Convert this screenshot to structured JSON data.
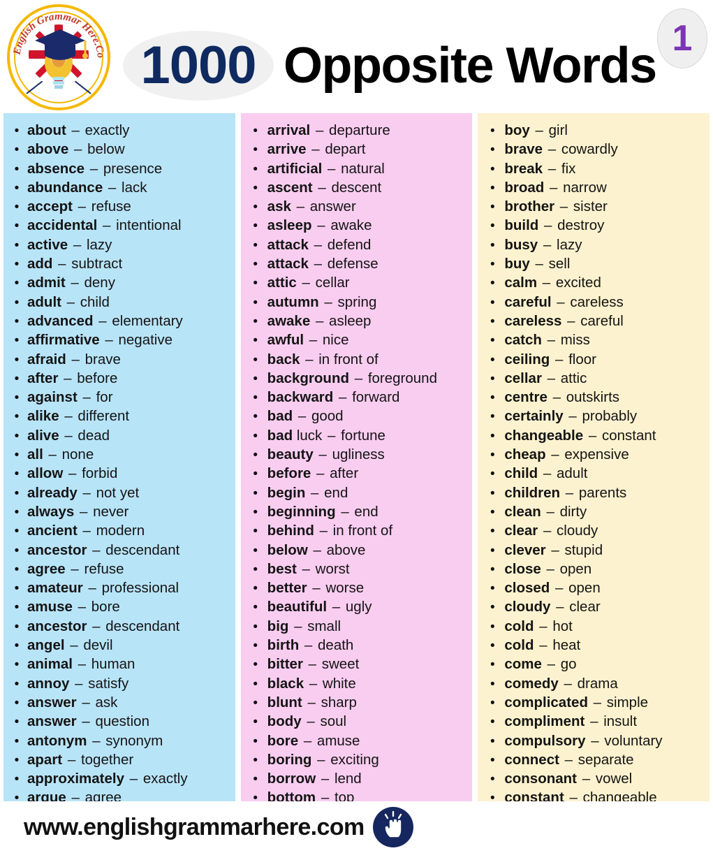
{
  "header": {
    "title_number": "1000",
    "title_text": "Opposite Words",
    "page_number": "1",
    "logo_text": "English Grammar Here.Com",
    "colors": {
      "number_navy": "#0e2a60",
      "page_badge_purple": "#7b35b5",
      "column_blue": "#b8e4f8",
      "column_pink": "#f9cdf0",
      "column_cream": "#fdf2cf",
      "footer_navy": "#16265e"
    }
  },
  "footer": {
    "site_url": "www.englishgrammarhere.com",
    "icon": "click-hand-icon"
  },
  "columns": [
    {
      "background": "#b8e4f8",
      "items": [
        {
          "word": "about",
          "opposite": "exactly"
        },
        {
          "word": "above",
          "opposite": "below"
        },
        {
          "word": "absence",
          "opposite": "presence"
        },
        {
          "word": "abundance",
          "opposite": "lack"
        },
        {
          "word": "accept",
          "opposite": "refuse"
        },
        {
          "word": "accidental",
          "opposite": "intentional"
        },
        {
          "word": "active",
          "opposite": "lazy"
        },
        {
          "word": "add",
          "opposite": "subtract"
        },
        {
          "word": "admit",
          "opposite": "deny"
        },
        {
          "word": "adult",
          "opposite": "child"
        },
        {
          "word": "advanced",
          "opposite": "elementary"
        },
        {
          "word": "affirmative",
          "opposite": "negative"
        },
        {
          "word": "afraid",
          "opposite": "brave"
        },
        {
          "word": "after",
          "opposite": "before"
        },
        {
          "word": "against",
          "opposite": "for"
        },
        {
          "word": "alike",
          "opposite": "different"
        },
        {
          "word": "alive",
          "opposite": "dead"
        },
        {
          "word": "all",
          "opposite": "none"
        },
        {
          "word": "allow",
          "opposite": "forbid"
        },
        {
          "word": "already",
          "opposite": "not yet"
        },
        {
          "word": "always",
          "opposite": "never"
        },
        {
          "word": "ancient",
          "opposite": "modern"
        },
        {
          "word": "ancestor",
          "opposite": "descendant"
        },
        {
          "word": "agree",
          "opposite": "refuse"
        },
        {
          "word": "amateur",
          "opposite": "professional"
        },
        {
          "word": "amuse",
          "opposite": "bore"
        },
        {
          "word": "ancestor",
          "opposite": "descendant"
        },
        {
          "word": "angel",
          "opposite": "devil"
        },
        {
          "word": "animal",
          "opposite": "human"
        },
        {
          "word": "annoy",
          "opposite": "satisfy"
        },
        {
          "word": "answer",
          "opposite": "ask"
        },
        {
          "word": "answer",
          "opposite": "question"
        },
        {
          "word": "antonym",
          "opposite": "synonym"
        },
        {
          "word": "apart",
          "opposite": "together"
        },
        {
          "word": "approximately",
          "opposite": "exactly"
        },
        {
          "word": "argue",
          "opposite": "agree"
        }
      ]
    },
    {
      "background": "#f9cdf0",
      "items": [
        {
          "word": "arrival",
          "opposite": "departure"
        },
        {
          "word": "arrive",
          "opposite": "depart"
        },
        {
          "word": "artificial",
          "opposite": "natural"
        },
        {
          "word": "ascent",
          "opposite": "descent"
        },
        {
          "word": "ask",
          "opposite": "answer"
        },
        {
          "word": "asleep",
          "opposite": "awake"
        },
        {
          "word": "attack",
          "opposite": "defend"
        },
        {
          "word": "attack",
          "opposite": "defense"
        },
        {
          "word": "attic",
          "opposite": "cellar"
        },
        {
          "word": "autumn",
          "opposite": "spring"
        },
        {
          "word": "awake",
          "opposite": "asleep"
        },
        {
          "word": "awful",
          "opposite": "nice"
        },
        {
          "word": "back",
          "opposite": "in front of"
        },
        {
          "word": "background",
          "opposite": "foreground"
        },
        {
          "word": "backward",
          "opposite": "forward"
        },
        {
          "word": "bad",
          "opposite": "good"
        },
        {
          "word": "bad",
          "suffix": "luck",
          "opposite": "fortune"
        },
        {
          "word": "beauty",
          "opposite": "ugliness"
        },
        {
          "word": "before",
          "opposite": "after"
        },
        {
          "word": "begin",
          "opposite": "end"
        },
        {
          "word": "beginning",
          "opposite": "end"
        },
        {
          "word": "behind",
          "opposite": "in front of"
        },
        {
          "word": "below",
          "opposite": "above"
        },
        {
          "word": "best",
          "opposite": "worst"
        },
        {
          "word": "better",
          "opposite": "worse"
        },
        {
          "word": "beautiful",
          "opposite": "ugly"
        },
        {
          "word": "big",
          "opposite": "small"
        },
        {
          "word": "birth",
          "opposite": "death"
        },
        {
          "word": "bitter",
          "opposite": "sweet"
        },
        {
          "word": "black",
          "opposite": "white"
        },
        {
          "word": "blunt",
          "opposite": "sharp"
        },
        {
          "word": "body",
          "opposite": "soul"
        },
        {
          "word": "bore",
          "opposite": "amuse"
        },
        {
          "word": "boring",
          "opposite": "exciting"
        },
        {
          "word": "borrow",
          "opposite": "lend"
        },
        {
          "word": "bottom",
          "opposite": "top"
        }
      ]
    },
    {
      "background": "#fdf2cf",
      "items": [
        {
          "word": "boy",
          "opposite": "girl"
        },
        {
          "word": "brave",
          "opposite": "cowardly"
        },
        {
          "word": "break",
          "opposite": "fix"
        },
        {
          "word": "broad",
          "opposite": "narrow"
        },
        {
          "word": "brother",
          "opposite": "sister"
        },
        {
          "word": "build",
          "opposite": "destroy"
        },
        {
          "word": "busy",
          "opposite": "lazy"
        },
        {
          "word": "buy",
          "opposite": "sell"
        },
        {
          "word": "calm",
          "opposite": "excited"
        },
        {
          "word": "careful",
          "opposite": "careless"
        },
        {
          "word": "careless",
          "opposite": "careful"
        },
        {
          "word": "catch",
          "opposite": "miss"
        },
        {
          "word": "ceiling",
          "opposite": "floor"
        },
        {
          "word": "cellar",
          "opposite": "attic"
        },
        {
          "word": "centre",
          "opposite": "outskirts"
        },
        {
          "word": "certainly",
          "opposite": "probably"
        },
        {
          "word": "changeable",
          "opposite": "constant"
        },
        {
          "word": "cheap",
          "opposite": "expensive"
        },
        {
          "word": "child",
          "opposite": "adult"
        },
        {
          "word": "children",
          "opposite": "parents"
        },
        {
          "word": "clean",
          "opposite": "dirty"
        },
        {
          "word": "clear",
          "opposite": "cloudy"
        },
        {
          "word": "clever",
          "opposite": "stupid"
        },
        {
          "word": "close",
          "opposite": "open"
        },
        {
          "word": "closed",
          "opposite": "open"
        },
        {
          "word": "cloudy",
          "opposite": "clear"
        },
        {
          "word": "cold",
          "opposite": "hot"
        },
        {
          "word": "cold",
          "opposite": "heat"
        },
        {
          "word": "come",
          "opposite": "go"
        },
        {
          "word": "comedy",
          "opposite": "drama"
        },
        {
          "word": "complicated",
          "opposite": "simple"
        },
        {
          "word": "compliment",
          "opposite": "insult"
        },
        {
          "word": "compulsory",
          "opposite": "voluntary"
        },
        {
          "word": "connect",
          "opposite": "separate"
        },
        {
          "word": "consonant",
          "opposite": "vowel"
        },
        {
          "word": "constant",
          "opposite": "changeable"
        }
      ]
    }
  ]
}
